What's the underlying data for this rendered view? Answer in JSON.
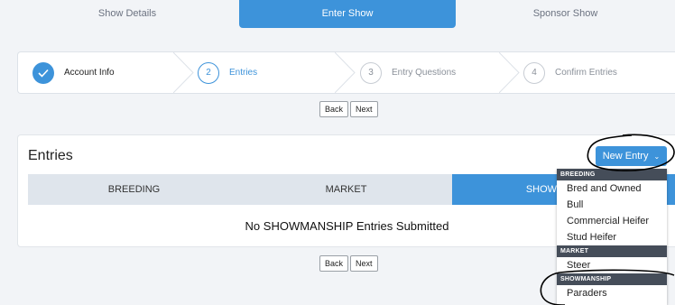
{
  "top_tabs": [
    {
      "label": "Show Details",
      "active": false
    },
    {
      "label": "Enter Show",
      "active": true
    },
    {
      "label": "Sponsor Show",
      "active": false
    }
  ],
  "steps": [
    {
      "number": "1",
      "label": "Account Info",
      "state": "done"
    },
    {
      "number": "2",
      "label": "Entries",
      "state": "current"
    },
    {
      "number": "3",
      "label": "Entry Questions",
      "state": "todo"
    },
    {
      "number": "4",
      "label": "Confirm Entries",
      "state": "todo"
    }
  ],
  "pager": {
    "back": "Back",
    "next": "Next"
  },
  "entries": {
    "title": "Entries",
    "new_entry_label": "New Entry",
    "tabs": [
      {
        "label": "BREEDING",
        "active": false
      },
      {
        "label": "MARKET",
        "active": false
      },
      {
        "label": "SHOWMANSHIP",
        "active": true
      }
    ],
    "empty_message": "No SHOWMANSHIP Entries Submitted"
  },
  "dropdown": {
    "groups": [
      {
        "header": "BREEDING",
        "items": [
          "Bred and Owned",
          "Bull",
          "Commercial Heifer",
          "Stud Heifer"
        ]
      },
      {
        "header": "MARKET",
        "items": [
          "Steer"
        ]
      },
      {
        "header": "SHOWMANSHIP",
        "items": [
          "Paraders"
        ]
      }
    ]
  },
  "colors": {
    "accent": "#3d93da",
    "dropdown_header": "#454d59",
    "annotation": "#000000"
  },
  "icons": {
    "check": "check-icon",
    "caret": "chevron-down-icon"
  }
}
